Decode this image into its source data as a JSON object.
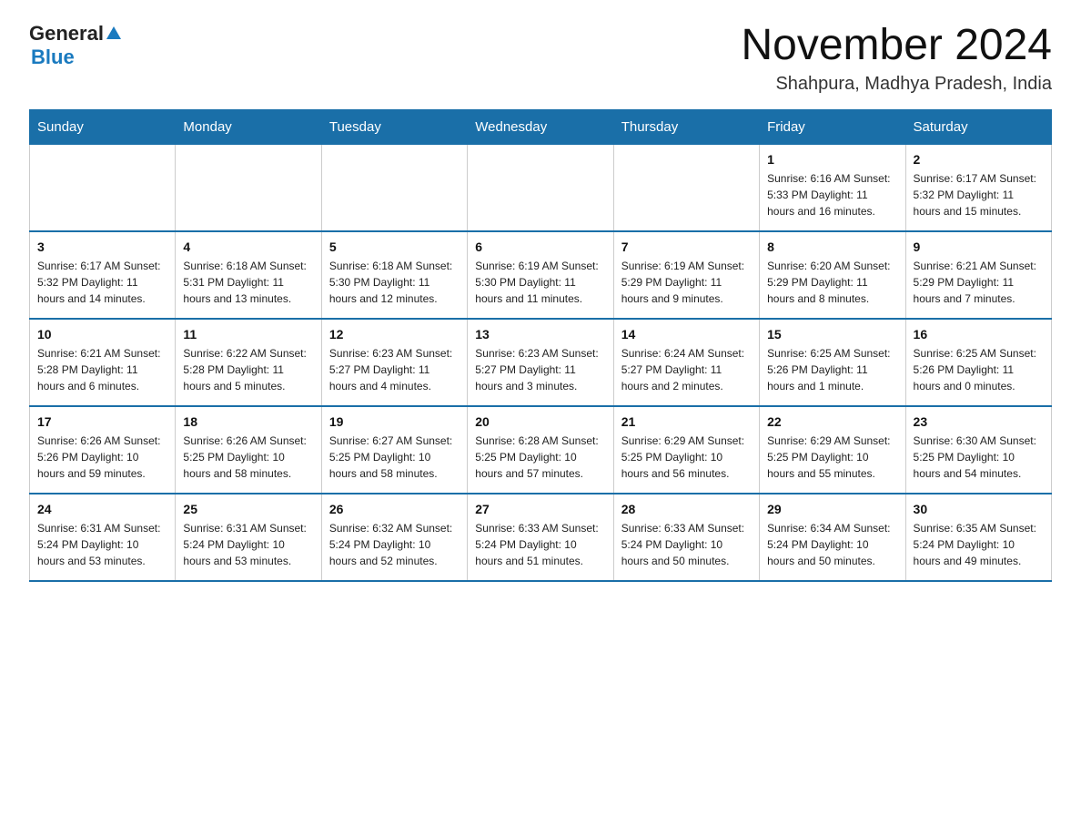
{
  "header": {
    "logo": {
      "part1": "General",
      "part2": "Blue"
    },
    "title": "November 2024",
    "subtitle": "Shahpura, Madhya Pradesh, India"
  },
  "calendar": {
    "days_of_week": [
      "Sunday",
      "Monday",
      "Tuesday",
      "Wednesday",
      "Thursday",
      "Friday",
      "Saturday"
    ],
    "weeks": [
      [
        {
          "day": "",
          "info": ""
        },
        {
          "day": "",
          "info": ""
        },
        {
          "day": "",
          "info": ""
        },
        {
          "day": "",
          "info": ""
        },
        {
          "day": "",
          "info": ""
        },
        {
          "day": "1",
          "info": "Sunrise: 6:16 AM\nSunset: 5:33 PM\nDaylight: 11 hours and 16 minutes."
        },
        {
          "day": "2",
          "info": "Sunrise: 6:17 AM\nSunset: 5:32 PM\nDaylight: 11 hours and 15 minutes."
        }
      ],
      [
        {
          "day": "3",
          "info": "Sunrise: 6:17 AM\nSunset: 5:32 PM\nDaylight: 11 hours and 14 minutes."
        },
        {
          "day": "4",
          "info": "Sunrise: 6:18 AM\nSunset: 5:31 PM\nDaylight: 11 hours and 13 minutes."
        },
        {
          "day": "5",
          "info": "Sunrise: 6:18 AM\nSunset: 5:30 PM\nDaylight: 11 hours and 12 minutes."
        },
        {
          "day": "6",
          "info": "Sunrise: 6:19 AM\nSunset: 5:30 PM\nDaylight: 11 hours and 11 minutes."
        },
        {
          "day": "7",
          "info": "Sunrise: 6:19 AM\nSunset: 5:29 PM\nDaylight: 11 hours and 9 minutes."
        },
        {
          "day": "8",
          "info": "Sunrise: 6:20 AM\nSunset: 5:29 PM\nDaylight: 11 hours and 8 minutes."
        },
        {
          "day": "9",
          "info": "Sunrise: 6:21 AM\nSunset: 5:29 PM\nDaylight: 11 hours and 7 minutes."
        }
      ],
      [
        {
          "day": "10",
          "info": "Sunrise: 6:21 AM\nSunset: 5:28 PM\nDaylight: 11 hours and 6 minutes."
        },
        {
          "day": "11",
          "info": "Sunrise: 6:22 AM\nSunset: 5:28 PM\nDaylight: 11 hours and 5 minutes."
        },
        {
          "day": "12",
          "info": "Sunrise: 6:23 AM\nSunset: 5:27 PM\nDaylight: 11 hours and 4 minutes."
        },
        {
          "day": "13",
          "info": "Sunrise: 6:23 AM\nSunset: 5:27 PM\nDaylight: 11 hours and 3 minutes."
        },
        {
          "day": "14",
          "info": "Sunrise: 6:24 AM\nSunset: 5:27 PM\nDaylight: 11 hours and 2 minutes."
        },
        {
          "day": "15",
          "info": "Sunrise: 6:25 AM\nSunset: 5:26 PM\nDaylight: 11 hours and 1 minute."
        },
        {
          "day": "16",
          "info": "Sunrise: 6:25 AM\nSunset: 5:26 PM\nDaylight: 11 hours and 0 minutes."
        }
      ],
      [
        {
          "day": "17",
          "info": "Sunrise: 6:26 AM\nSunset: 5:26 PM\nDaylight: 10 hours and 59 minutes."
        },
        {
          "day": "18",
          "info": "Sunrise: 6:26 AM\nSunset: 5:25 PM\nDaylight: 10 hours and 58 minutes."
        },
        {
          "day": "19",
          "info": "Sunrise: 6:27 AM\nSunset: 5:25 PM\nDaylight: 10 hours and 58 minutes."
        },
        {
          "day": "20",
          "info": "Sunrise: 6:28 AM\nSunset: 5:25 PM\nDaylight: 10 hours and 57 minutes."
        },
        {
          "day": "21",
          "info": "Sunrise: 6:29 AM\nSunset: 5:25 PM\nDaylight: 10 hours and 56 minutes."
        },
        {
          "day": "22",
          "info": "Sunrise: 6:29 AM\nSunset: 5:25 PM\nDaylight: 10 hours and 55 minutes."
        },
        {
          "day": "23",
          "info": "Sunrise: 6:30 AM\nSunset: 5:25 PM\nDaylight: 10 hours and 54 minutes."
        }
      ],
      [
        {
          "day": "24",
          "info": "Sunrise: 6:31 AM\nSunset: 5:24 PM\nDaylight: 10 hours and 53 minutes."
        },
        {
          "day": "25",
          "info": "Sunrise: 6:31 AM\nSunset: 5:24 PM\nDaylight: 10 hours and 53 minutes."
        },
        {
          "day": "26",
          "info": "Sunrise: 6:32 AM\nSunset: 5:24 PM\nDaylight: 10 hours and 52 minutes."
        },
        {
          "day": "27",
          "info": "Sunrise: 6:33 AM\nSunset: 5:24 PM\nDaylight: 10 hours and 51 minutes."
        },
        {
          "day": "28",
          "info": "Sunrise: 6:33 AM\nSunset: 5:24 PM\nDaylight: 10 hours and 50 minutes."
        },
        {
          "day": "29",
          "info": "Sunrise: 6:34 AM\nSunset: 5:24 PM\nDaylight: 10 hours and 50 minutes."
        },
        {
          "day": "30",
          "info": "Sunrise: 6:35 AM\nSunset: 5:24 PM\nDaylight: 10 hours and 49 minutes."
        }
      ]
    ]
  }
}
